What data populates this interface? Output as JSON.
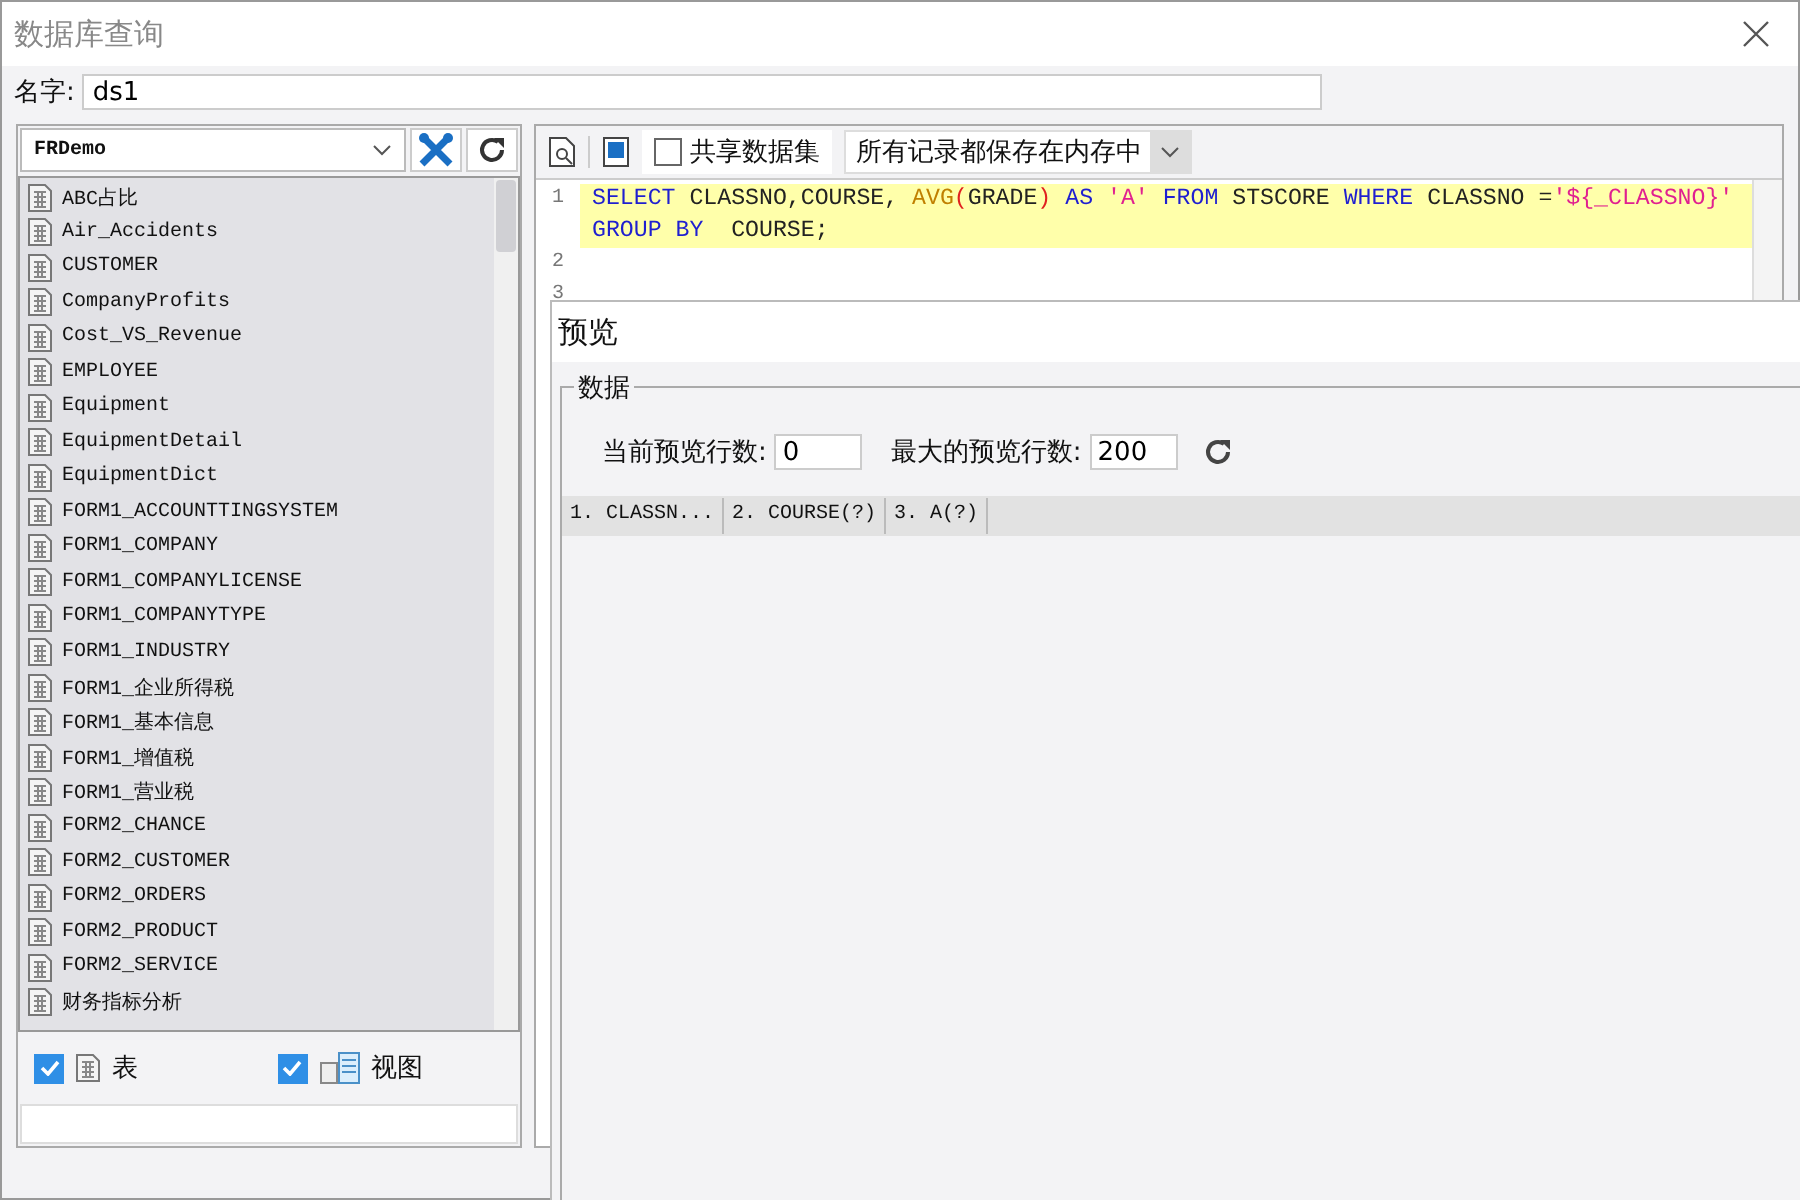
{
  "window": {
    "title": "数据库查询"
  },
  "name_field": {
    "label": "名字:",
    "value": "ds1"
  },
  "connection": {
    "value": "FRDemo"
  },
  "tables": [
    {
      "name": "ABC占比"
    },
    {
      "name": "Air_Accidents"
    },
    {
      "name": "CUSTOMER"
    },
    {
      "name": "CompanyProfits"
    },
    {
      "name": "Cost_VS_Revenue"
    },
    {
      "name": "EMPLOYEE"
    },
    {
      "name": "Equipment"
    },
    {
      "name": "EquipmentDetail"
    },
    {
      "name": "EquipmentDict"
    },
    {
      "name": "FORM1_ACCOUNTTINGSYSTEM"
    },
    {
      "name": "FORM1_COMPANY"
    },
    {
      "name": "FORM1_COMPANYLICENSE"
    },
    {
      "name": "FORM1_COMPANYTYPE"
    },
    {
      "name": "FORM1_INDUSTRY"
    },
    {
      "name": "FORM1_企业所得税"
    },
    {
      "name": "FORM1_基本信息"
    },
    {
      "name": "FORM1_增值税"
    },
    {
      "name": "FORM1_营业税"
    },
    {
      "name": "FORM2_CHANCE"
    },
    {
      "name": "FORM2_CUSTOMER"
    },
    {
      "name": "FORM2_ORDERS"
    },
    {
      "name": "FORM2_PRODUCT"
    },
    {
      "name": "FORM2_SERVICE"
    },
    {
      "name": "财务指标分析"
    }
  ],
  "filters": [
    {
      "kind": "table",
      "label": "表",
      "checked": true
    },
    {
      "kind": "view",
      "label": "视图",
      "checked": true
    }
  ],
  "toolbar": {
    "shared": {
      "label": "共享数据集",
      "checked": false
    },
    "storage": {
      "value": "所有记录都保存在内存中"
    }
  },
  "editor": {
    "lines": [
      {
        "number": "1",
        "current": true,
        "rows": [
          [
            {
              "kind": "keyword",
              "text": "SELECT"
            },
            {
              "kind": "plain",
              "text": " CLASSNO,COURSE, "
            },
            {
              "kind": "func",
              "text": "AVG"
            },
            {
              "kind": "paren",
              "text": "("
            },
            {
              "kind": "plain",
              "text": "GRADE"
            },
            {
              "kind": "paren",
              "text": ")"
            },
            {
              "kind": "plain",
              "text": " "
            },
            {
              "kind": "keyword",
              "text": "AS"
            },
            {
              "kind": "plain",
              "text": " "
            },
            {
              "kind": "string",
              "text": "'A'"
            },
            {
              "kind": "plain",
              "text": " "
            },
            {
              "kind": "keyword",
              "text": "FROM"
            },
            {
              "kind": "plain",
              "text": " STSCORE "
            },
            {
              "kind": "keyword",
              "text": "WHERE"
            },
            {
              "kind": "plain",
              "text": " CLASSNO ="
            },
            {
              "kind": "string",
              "text": "'${_CLASSNO}'"
            }
          ],
          [
            {
              "kind": "keyword",
              "text": "GROUP BY"
            },
            {
              "kind": "plain",
              "text": "  COURSE;"
            }
          ]
        ]
      },
      {
        "number": "2",
        "current": false,
        "rows": [
          []
        ]
      },
      {
        "number": "3",
        "current": false,
        "rows": [
          []
        ]
      }
    ]
  },
  "preview": {
    "title": "预览",
    "group": "数据",
    "current_rows": {
      "label": "当前预览行数:",
      "value": "0"
    },
    "max_rows": {
      "label": "最大的预览行数:",
      "value": "200"
    },
    "columns": [
      "1. CLASSN...",
      "2. COURSE(?)",
      "3. A(?)"
    ]
  }
}
